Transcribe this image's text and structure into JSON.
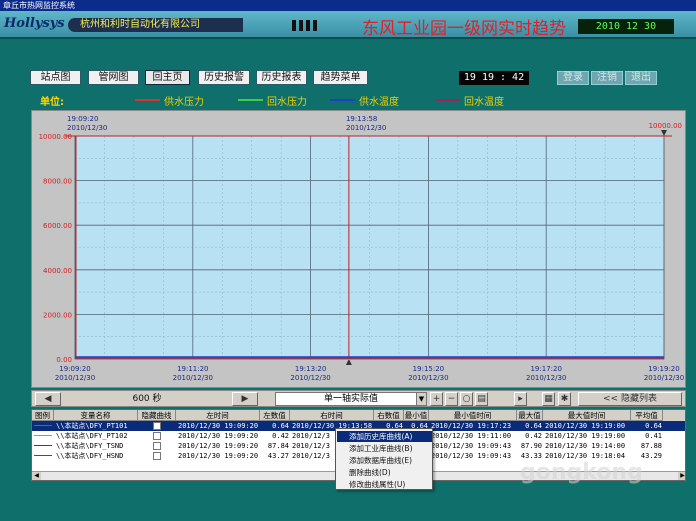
{
  "window": {
    "title": "章丘市热网监控系统"
  },
  "header": {
    "brand": "Hollysys",
    "company": "杭州和利时自动化有限公司",
    "title": "东风工业园一级网实时趋势",
    "date": "2010  12  30"
  },
  "nav": {
    "buttons": [
      "站点图",
      "管网图",
      "回主页",
      "历史报警",
      "历史报表",
      "趋势菜单"
    ],
    "time": "19  19 : 42",
    "actions": [
      "登录",
      "注销",
      "退出"
    ]
  },
  "legend": {
    "unit_label": "单位:",
    "items": [
      {
        "label": "供水压力",
        "color": "#e03030"
      },
      {
        "label": "回水压力",
        "color": "#40d040"
      },
      {
        "label": "供水温度",
        "color": "#2040c0"
      },
      {
        "label": "回水温度",
        "color": "#a02060"
      }
    ]
  },
  "chart_data": {
    "type": "line",
    "ylim": [
      0,
      10000
    ],
    "y_ticks": [
      "0.00",
      "2000.00",
      "4000.00",
      "6000.00",
      "8000.00",
      "10000.00"
    ],
    "y_tick_values": [
      0,
      2000,
      4000,
      6000,
      8000,
      10000
    ],
    "x_ticks": [
      {
        "time": "19:09:20",
        "date": "2010/12/30"
      },
      {
        "time": "19:11:20",
        "date": "2010/12/30"
      },
      {
        "time": "19:13:20",
        "date": "2010/12/30"
      },
      {
        "time": "19:15:20",
        "date": "2010/12/30"
      },
      {
        "time": "19:17:20",
        "date": "2010/12/30"
      },
      {
        "time": "19:19:20",
        "date": "2010/12/30"
      }
    ],
    "top_labels": [
      {
        "time": "19:09:20",
        "date": "2010/12/30"
      },
      {
        "time": "19:13:58",
        "date": "2010/12/30"
      }
    ],
    "top_right_value": "10000.00",
    "series": [
      {
        "name": "供水压力",
        "color": "#e03030",
        "values": [
          0.64,
          0.64
        ]
      },
      {
        "name": "回水压力",
        "color": "#40d040",
        "values": [
          0.42,
          0.41
        ]
      },
      {
        "name": "供水温度",
        "color": "#2040c0",
        "values": [
          87.84,
          87.88
        ]
      },
      {
        "name": "回水温度",
        "color": "#a02060",
        "values": [
          43.27,
          43.29
        ]
      }
    ],
    "grid": true,
    "background": "#b8e2f4"
  },
  "toolbar": {
    "period": "600 秒",
    "axis_mode": "单一轴实际值",
    "hide_list": "<< 隐藏列表"
  },
  "table": {
    "headers": [
      "图例",
      "变量名称",
      "隐藏曲线",
      "左时间",
      "左数值",
      "右时间",
      "右数值",
      "最小值",
      "最小值时间",
      "最大值",
      "最大值时间",
      "平均值"
    ],
    "rows": [
      {
        "name": "\\\\本站点\\DFY_PT101",
        "color": "#e03030",
        "left_time": "2010/12/30 19:09:20",
        "left_val": "0.64",
        "right_time": "2010/12/30 19:13:58",
        "right_val": "0.64",
        "min": "0.64",
        "min_time": "2010/12/30 19:17:23",
        "max": "0.64",
        "max_time": "2010/12/30 19:19:00",
        "avg": "0.64",
        "selected": true
      },
      {
        "name": "\\\\本站点\\DFY_PT102",
        "color": "#40d040",
        "left_time": "2010/12/30 19:09:20",
        "left_val": "0.42",
        "right_time": "2010/12/3",
        "right_val": "",
        "min": "",
        "min_time": "2010/12/30 19:11:00",
        "max": "0.42",
        "max_time": "2010/12/30 19:19:00",
        "avg": "0.41",
        "selected": false
      },
      {
        "name": "\\\\本站点\\DFY_TSND",
        "color": "#2040c0",
        "left_time": "2010/12/30 19:09:20",
        "left_val": "87.84",
        "right_time": "2010/12/3",
        "right_val": "",
        "min": "4",
        "min_time": "2010/12/30 19:09:43",
        "max": "87.90",
        "max_time": "2010/12/30 19:14:00",
        "avg": "87.88",
        "selected": false
      },
      {
        "name": "\\\\本站点\\DFY_HSND",
        "color": "#a02060",
        "left_time": "2010/12/30 19:09:20",
        "left_val": "43.27",
        "right_time": "2010/12/3",
        "right_val": "",
        "min": "7",
        "min_time": "2010/12/30 19:09:43",
        "max": "43.33",
        "max_time": "2010/12/30 19:18:04",
        "avg": "43.29",
        "selected": false
      }
    ]
  },
  "context_menu": {
    "items": [
      "添加历史库曲线(A)",
      "添加工业库曲线(B)",
      "添加数据库曲线(E)",
      "删除曲线(D)",
      "修改曲线属性(U)"
    ]
  },
  "watermark": "gongkong"
}
